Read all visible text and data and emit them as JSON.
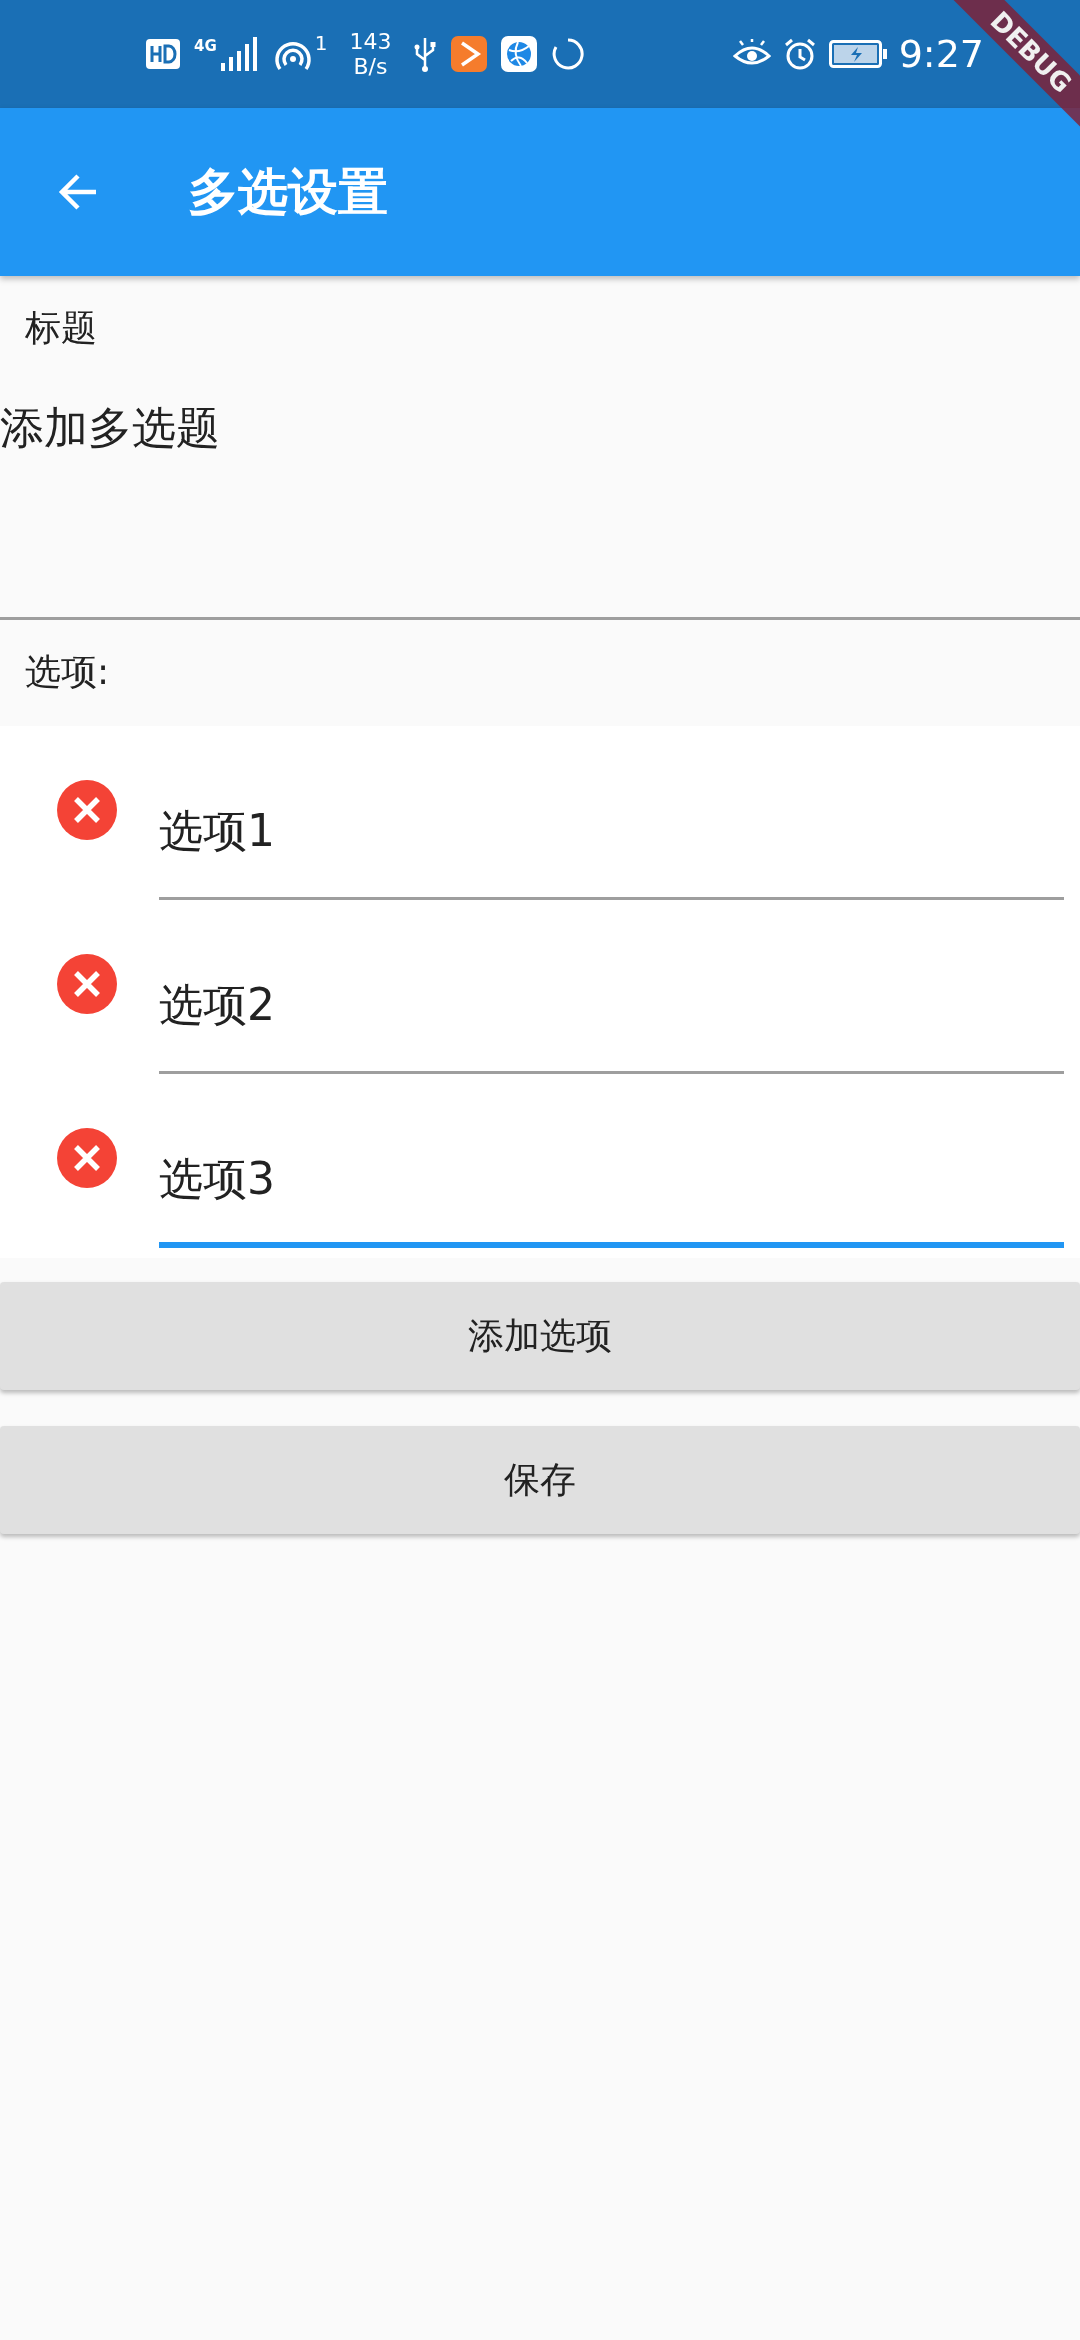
{
  "status_bar": {
    "network": "4G",
    "hotspot_count": "1",
    "speed_value": "143",
    "speed_unit": "B/s",
    "time": "9:27"
  },
  "debug_banner": "DEBUG",
  "app_bar": {
    "title": "多选设置"
  },
  "title_field": {
    "label": "标题",
    "value": "添加多选题"
  },
  "options_label": "选项:",
  "options": [
    {
      "value": "选项1",
      "focused": false
    },
    {
      "value": "选项2",
      "focused": false
    },
    {
      "value": "选项3",
      "focused": true
    }
  ],
  "buttons": [
    "添加选项",
    "保存"
  ]
}
